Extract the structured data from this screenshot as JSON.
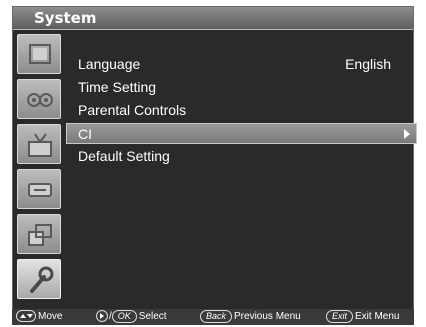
{
  "window": {
    "title": "System"
  },
  "sidebar": {
    "tabs": [
      {
        "name": "picture-icon"
      },
      {
        "name": "sound-icon"
      },
      {
        "name": "channel-icon"
      },
      {
        "name": "input-icon"
      },
      {
        "name": "pip-icon"
      },
      {
        "name": "system-wrench-icon",
        "active": true
      }
    ]
  },
  "menu": {
    "items": [
      {
        "label": "Language",
        "value": "English"
      },
      {
        "label": "Time Setting"
      },
      {
        "label": "Parental Controls"
      },
      {
        "label": "CI",
        "selected": true
      },
      {
        "label": "Default Setting"
      }
    ]
  },
  "help": {
    "move": "Move",
    "select_key": "OK",
    "select": "Select",
    "back_key": "Back",
    "previous": "Previous Menu",
    "exit_key": "Exit",
    "exit": "Exit Menu"
  }
}
